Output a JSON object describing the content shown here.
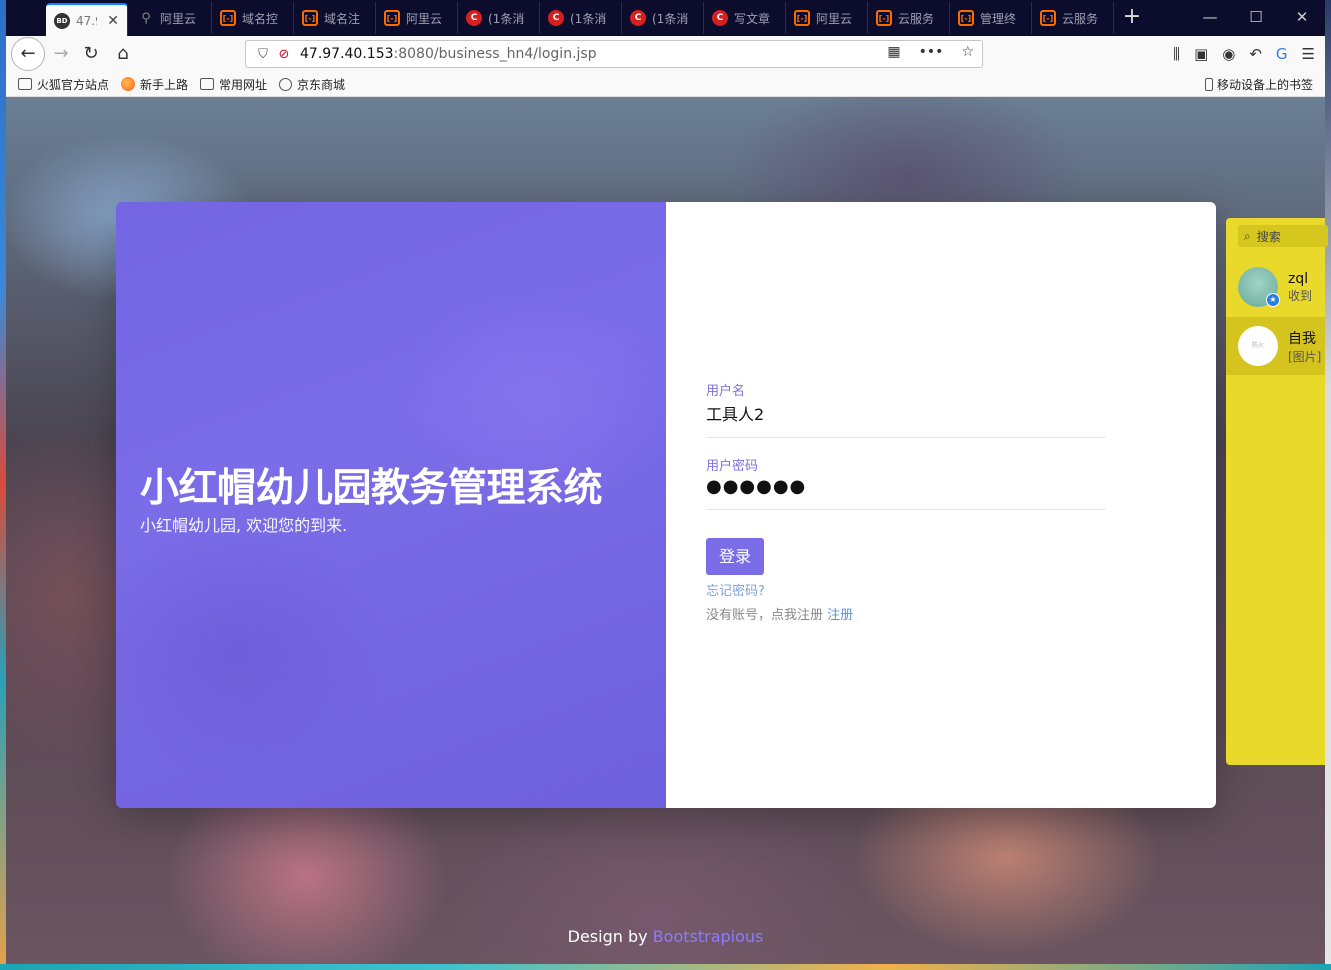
{
  "browser": {
    "tabs": [
      {
        "icon": "baidu-icon",
        "fav": "BD",
        "title": "47.9",
        "active": true
      },
      {
        "icon": "aliyun-icon",
        "fav": "",
        "title": "阿里云"
      },
      {
        "icon": "aliyun-icon",
        "fav": "",
        "title": "域名控"
      },
      {
        "icon": "aliyun-icon",
        "fav": "",
        "title": "域名注"
      },
      {
        "icon": "aliyun-icon",
        "fav": "",
        "title": "阿里云"
      },
      {
        "icon": "csdn-icon",
        "fav": "C",
        "title": "(1条消"
      },
      {
        "icon": "csdn-icon",
        "fav": "C",
        "title": "(1条消"
      },
      {
        "icon": "csdn-icon",
        "fav": "C",
        "title": "(1条消"
      },
      {
        "icon": "csdn-icon",
        "fav": "C",
        "title": "写文章"
      },
      {
        "icon": "aliyun-icon",
        "fav": "",
        "title": "阿里云"
      },
      {
        "icon": "aliyun-icon",
        "fav": "",
        "title": "云服务"
      },
      {
        "icon": "aliyun-icon",
        "fav": "",
        "title": "管理终"
      },
      {
        "icon": "aliyun-icon",
        "fav": "",
        "title": "云服务"
      }
    ],
    "url": {
      "host": "47.97.40.153",
      "path": ":8080/business_hn4/login.jsp"
    },
    "bookmarks": [
      {
        "icon": "folder",
        "label": "火狐官方站点"
      },
      {
        "icon": "fox",
        "label": "新手上路"
      },
      {
        "icon": "folder",
        "label": "常用网址"
      },
      {
        "icon": "globe",
        "label": "京东商城"
      }
    ],
    "mobile_bookmarks": "移动设备上的书签"
  },
  "login": {
    "title": "小红帽幼儿园教务管理系统",
    "subtitle": "小红帽幼儿园, 欢迎您的到来.",
    "username_label": "用户名",
    "username_value": "工具人2",
    "password_label": "用户密码",
    "password_value": "●●●●●●",
    "login_button": "登录",
    "forgot": "忘记密码?",
    "no_account": "没有账号，点我注册",
    "register": "注册"
  },
  "footer": {
    "prefix": "Design by",
    "brand": "Bootstrapious",
    "brand_color": "#8a7cff"
  },
  "chat": {
    "search_placeholder": "搜索",
    "contacts": [
      {
        "name": "zql",
        "preview": "收到"
      },
      {
        "name": "自我",
        "preview": "[图片]",
        "avatar_text": "防火"
      }
    ]
  },
  "colors": {
    "accent": "#7b6ce8",
    "tabstrip": "#0c0c2d",
    "chat_bg": "#e8d92a"
  }
}
